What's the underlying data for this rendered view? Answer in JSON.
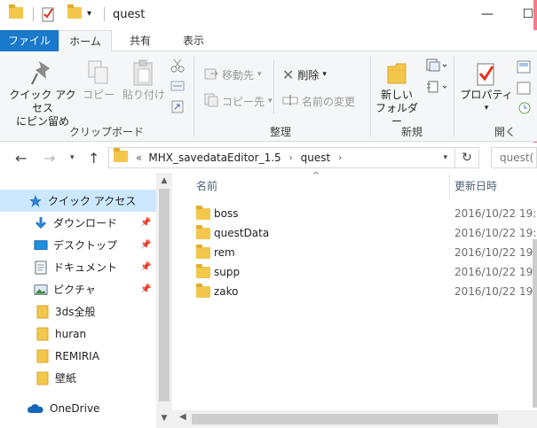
{
  "window": {
    "title": "quest",
    "minimize": "—",
    "maximize": "☐"
  },
  "ribbon_tabs": {
    "file": "ファイル",
    "home": "ホーム",
    "share": "共有",
    "view": "表示"
  },
  "ribbon": {
    "pin_quick_access": [
      "クイック アクセス",
      "にピン留め"
    ],
    "copy": "コピー",
    "paste": "貼り付け",
    "move_to": "移動先",
    "copy_to": "コピー先",
    "delete": "削除",
    "rename": "名前の変更",
    "new_folder": [
      "新しい",
      "フォルダー"
    ],
    "properties": "プロパティ",
    "groups": {
      "clipboard": "クリップボード",
      "organize": "整理",
      "new": "新規",
      "open": "開く"
    }
  },
  "address": {
    "overflow": "«",
    "crumbs": [
      "MHX_savedataEditor_1.5",
      "quest"
    ],
    "search_placeholder": "quest(",
    "refresh": "↻"
  },
  "nav": {
    "items": [
      {
        "label": "クイック アクセス",
        "icon": "star-icon",
        "pinned": false,
        "selected": true
      },
      {
        "label": "ダウンロード",
        "icon": "download-icon",
        "pinned": true
      },
      {
        "label": "デスクトップ",
        "icon": "desktop-icon",
        "pinned": true
      },
      {
        "label": "ドキュメント",
        "icon": "document-icon",
        "pinned": true
      },
      {
        "label": "ピクチャ",
        "icon": "pictures-icon",
        "pinned": true
      },
      {
        "label": "3ds全般",
        "icon": "folder-icon",
        "pinned": false
      },
      {
        "label": "huran",
        "icon": "folder-icon",
        "pinned": false
      },
      {
        "label": "REMIRIA",
        "icon": "folder-icon",
        "pinned": false
      },
      {
        "label": "壁紙",
        "icon": "folder-icon",
        "pinned": false
      },
      {
        "label": "OneDrive",
        "icon": "cloud-icon",
        "pinned": false
      }
    ]
  },
  "file_list": {
    "columns": {
      "name": "名前",
      "modified": "更新日時"
    },
    "rows": [
      {
        "name": "boss",
        "modified": "2016/10/22 19:"
      },
      {
        "name": "questData",
        "modified": "2016/10/22 19:"
      },
      {
        "name": "rem",
        "modified": "2016/10/22 19:"
      },
      {
        "name": "supp",
        "modified": "2016/10/22 19:"
      },
      {
        "name": "zako",
        "modified": "2016/10/22 19:"
      }
    ]
  },
  "colors": {
    "accent": "#1979ca",
    "selection": "#cce8ff",
    "folder": "#f3c64c"
  }
}
